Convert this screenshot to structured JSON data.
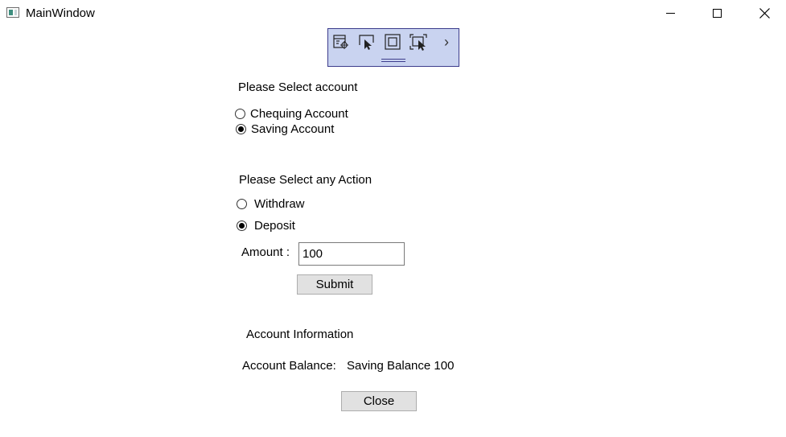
{
  "window": {
    "title": "MainWindow"
  },
  "debug_toolbar": {
    "tools": [
      "select-element-icon",
      "pointer-icon",
      "focus-frame-icon",
      "layout-adorner-icon",
      "chevron-right-icon"
    ],
    "expand_glyph": "›"
  },
  "account": {
    "heading": "Please Select account",
    "options": [
      {
        "label": "Chequing Account",
        "checked": false
      },
      {
        "label": "Saving Account",
        "checked": true
      }
    ]
  },
  "action": {
    "heading": "Please Select any Action",
    "options": [
      {
        "label": "Withdraw",
        "checked": false
      },
      {
        "label": "Deposit",
        "checked": true
      }
    ]
  },
  "amount": {
    "label": "Amount :",
    "value": "100"
  },
  "buttons": {
    "submit": "Submit",
    "close": "Close"
  },
  "info": {
    "heading": "Account Information",
    "balance_label": "Account Balance:",
    "balance_value": "Saving Balance 100"
  }
}
